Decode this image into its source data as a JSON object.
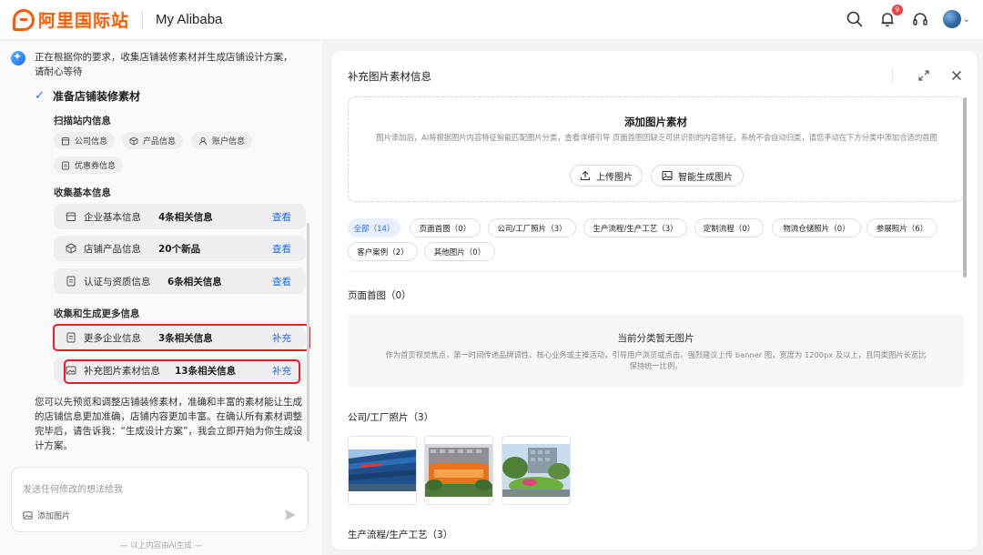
{
  "header": {
    "logo_text": "阿里国际站",
    "title": "My Alibaba",
    "notification_count": "9",
    "icons": [
      "search-icon",
      "bell-icon",
      "headset-icon",
      "avatar"
    ],
    "brand_color": "#ff5a00"
  },
  "left": {
    "intro": "正在根据你的要求，收集店铺装修素材并生成店铺设计方案，请耐心等待",
    "step_title": "准备店铺装修素材",
    "scan": {
      "title": "扫描站内信息",
      "chips": [
        {
          "label": "公司信息",
          "icon": "store-icon"
        },
        {
          "label": "产品信息",
          "icon": "box-icon"
        },
        {
          "label": "账户信息",
          "icon": "user-icon"
        },
        {
          "label": "优惠券信息",
          "icon": "coupon-icon"
        }
      ]
    },
    "basic": {
      "title": "收集基本信息",
      "rows": [
        {
          "label": "企业基本信息",
          "value": "4条相关信息",
          "action": "查看",
          "icon": "store-icon"
        },
        {
          "label": "店铺产品信息",
          "value": "20个新品",
          "action": "查看",
          "icon": "box-icon"
        },
        {
          "label": "认证与资质信息",
          "value": "6条相关信息",
          "action": "查看",
          "icon": "doc-icon"
        }
      ]
    },
    "more": {
      "title": "收集和生成更多信息",
      "rows": [
        {
          "label": "更多企业信息",
          "value": "3条相关信息",
          "action": "补充",
          "icon": "doc-icon"
        },
        {
          "label": "补充图片素材信息",
          "value": "13条相关信息",
          "action": "补充",
          "icon": "image-icon"
        }
      ]
    },
    "outro": "您可以先预览和调整店铺装修素材，准确和丰富的素材能让生成的店铺信息更加准确，店铺内容更加丰富。在确认所有素材调整完毕后，请告诉我：“生成设计方案”，我会立即开始为你生成设计方案。",
    "input": {
      "placeholder": "发送任何修改的想法给我",
      "add_image": "添加图片"
    },
    "footnote": "— 以上内容由AI生成 —",
    "accent_color": "#1f6bff",
    "highlight_color": "#e21f2b"
  },
  "right": {
    "title": "补充图片素材信息",
    "upload": {
      "title": "添加图片素材",
      "desc": "图片添加后，AI将根据图片内容特征智能匹配图片分类，查看详细引导 页面首图因缺乏可供识别的内容特征，系统不会自动归类，请您手动在下方分类中添加合适的首图",
      "upload_btn": "上传图片",
      "ai_btn": "智能生成图片"
    },
    "tabs": [
      {
        "label": "全部（14）",
        "active": true
      },
      {
        "label": "页面首图（0）"
      },
      {
        "label": "公司/工厂照片（3）"
      },
      {
        "label": "生产流程/生产工艺（3）"
      },
      {
        "label": "定制流程（0）"
      },
      {
        "label": "物流仓储照片（0）"
      },
      {
        "label": "参展照片（6）"
      },
      {
        "label": "客户案例（2）"
      },
      {
        "label": "其他图片（0）"
      }
    ],
    "sections": {
      "homepage": {
        "title": "页面首图（0）",
        "empty_title": "当前分类暂无图片",
        "empty_desc": "作为首页视觉焦点，第一时间传递品牌调性、核心业务或主推活动，引导用户浏览或点击。强烈建议上传 banner 图，宽度为 1200px 及以上，且同类图片长宽比保持统一比例。"
      },
      "company": {
        "title": "公司/工厂照片（3）",
        "thumbs": [
          "company-building-photo",
          "alibaba-campus-photo",
          "campus-garden-photo"
        ]
      },
      "production": {
        "title": "生产流程/生产工艺（3）"
      }
    }
  }
}
